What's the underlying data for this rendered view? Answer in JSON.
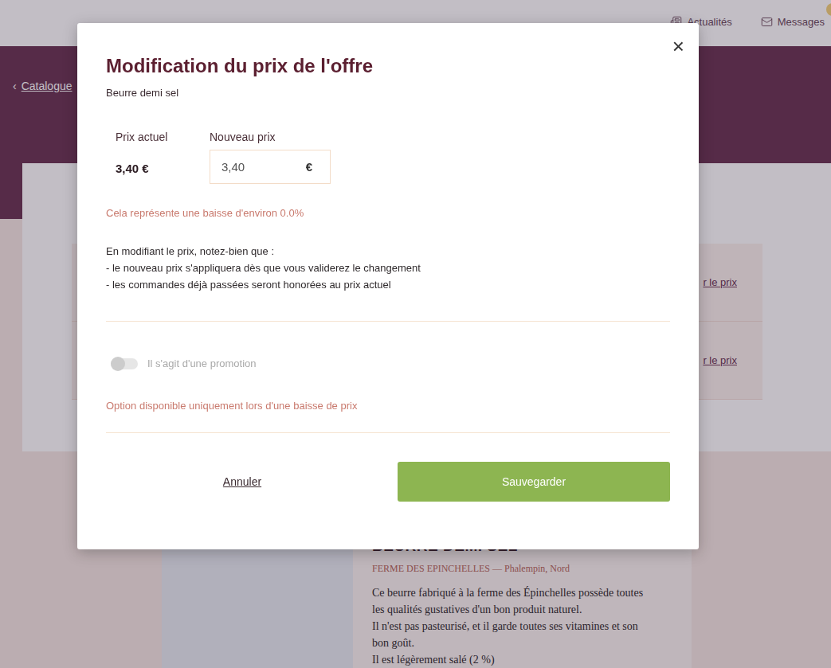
{
  "header": {
    "nav": [
      {
        "label": "Actualités",
        "icon": "news"
      },
      {
        "label": "Messages",
        "icon": "mail"
      }
    ]
  },
  "breadcrumb": {
    "icon": "‹",
    "label": "Catalogue"
  },
  "offer_rows": [
    {
      "link": "r le prix"
    },
    {
      "link": "r le prix"
    }
  ],
  "product": {
    "title": "BEURRE DEMI SEL",
    "farm": "FERME DES EPINCHELLES — Phalempin, Nord",
    "description": [
      "Ce beurre fabriqué à la ferme des Épinchelles possède toutes",
      "les qualités gustatives d'un bon produit naturel.",
      "Il n'est pas pasteurisé, et il garde toutes ses vitamines et son",
      "bon goût.",
      "Il est légèrement salé (2 %)"
    ]
  },
  "modal": {
    "title": "Modification du prix de l'offre",
    "subtitle": "Beurre demi sel",
    "close": "×",
    "current_price": {
      "label": "Prix actuel",
      "value": "3,40 €"
    },
    "new_price": {
      "label": "Nouveau prix",
      "value": "3,40",
      "unit": "€"
    },
    "variation": "Cela représente une baisse d'environ 0.0%",
    "notice": [
      "En modifiant le prix, notez-bien que :",
      "- le nouveau prix s'appliquera dès que vous validerez le changement",
      "- les commandes déjà passées seront honorées au prix actuel"
    ],
    "promotion": {
      "label": "Il s'agit d'une promotion",
      "on": false,
      "disabled": true
    },
    "promotion_hint": "Option disponible uniquement lors d'une baisse de prix",
    "buttons": {
      "cancel": "Annuler",
      "save": "Sauvegarder"
    }
  }
}
